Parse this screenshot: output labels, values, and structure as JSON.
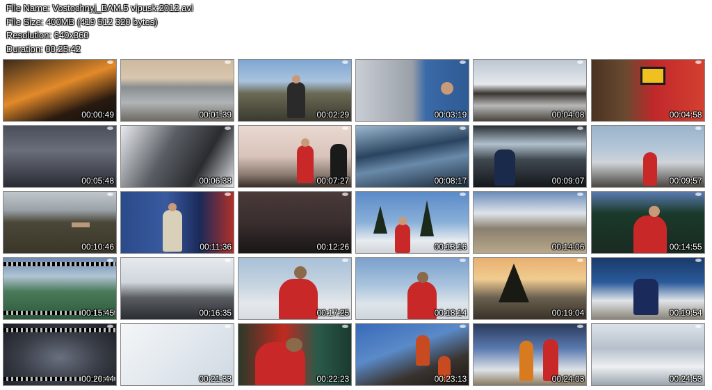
{
  "file_info": {
    "name_line": "File Name: Vostochnyj_BAM.5 vipusk:2012.avi",
    "size_line": "File Size: 400MB (419 512 320 bytes)",
    "resolution_line": "Resolution: 640x360",
    "duration_line": "Duration: 00:25:42"
  },
  "thumbnails": [
    {
      "time": "00:00:49",
      "bg": "linear-gradient(160deg,#3a2a1a 0%,#e28a2a 45%,#2a1a10 75%,#111 100%)"
    },
    {
      "time": "00:01:39",
      "bg": "linear-gradient(180deg,#cdb9a0 0%,#d8c6ae 30%,#8a8e90 45%,#b0b4b6 70%,#6e6a62 100%)"
    },
    {
      "time": "00:02:29",
      "bg": "linear-gradient(180deg,#7fa6d2 0%,#a9c3de 35%,#6a6a55 55%,#3a3a30 100%)"
    },
    {
      "time": "00:03:19",
      "bg": "linear-gradient(90deg,#c9cdd4 0%,#9aa0a8 50%,#3a6aa8 62%,#2f5a94 100%)"
    },
    {
      "time": "00:04:08",
      "bg": "linear-gradient(180deg,#bcc6d2 0%,#e5e8ec 40%,#3a3530 55%,#b8b8b8 75%,#4a443c 100%)"
    },
    {
      "time": "00:04:58",
      "bg": "linear-gradient(90deg,#4a3222 0%,#6a4a30 30%,#c0282a 55%,#d44030 100%)"
    },
    {
      "time": "00:05:48",
      "bg": "linear-gradient(180deg,#4a4e5a 0%,#6a6e7a 40%,#2a2c34 100%)"
    },
    {
      "time": "00:06:38",
      "bg": "linear-gradient(120deg,#e8eaee 0%,#5a5e64 40%,#2a2c30 70%,#dfe2e6 100%)"
    },
    {
      "time": "00:07:27",
      "bg": "linear-gradient(180deg,#e9d9d0 0%,#d9c3bb 50%,#8a7a70 80%,#3a2e28 100%)"
    },
    {
      "time": "00:08:17",
      "bg": "linear-gradient(170deg,#9cb8d0 0%,#2a4460 40%,#6a8aaa 60%,#1a2a3a 100%)"
    },
    {
      "time": "00:09:07",
      "bg": "linear-gradient(180deg,#2a3036 0%,#b0c0cc 30%,#404850 55%,#14181c 100%)"
    },
    {
      "time": "00:09:57",
      "bg": "linear-gradient(180deg,#9ab4cc 0%,#b6c8d8 40%,#cfd4d8 60%,#4a4640 100%)"
    },
    {
      "time": "00:10:46",
      "bg": "linear-gradient(180deg,#c0c6cc 0%,#9aa2a8 30%,#4a4638 50%,#3a3628 100%)"
    },
    {
      "time": "00:11:36",
      "bg": "linear-gradient(90deg,#2a4a8a 0%,#3a5aa0 40%,#1a2a5a 70%,#b0302a 100%)"
    },
    {
      "time": "00:12:26",
      "bg": "linear-gradient(180deg,#4a3a3a 0%,#3a2e2e 50%,#1a1616 100%)"
    },
    {
      "time": "00:13:16",
      "bg": "linear-gradient(180deg,#5a8ac8 0%,#8ab0d8 50%,#e8ecf0 80%,#d0d4d8 100%)"
    },
    {
      "time": "00:14:06",
      "bg": "linear-gradient(180deg,#6a8cb8 0%,#dfe4ea 35%,#8a8070 60%,#b8a88a 100%)"
    },
    {
      "time": "00:14:55",
      "bg": "linear-gradient(180deg,#5a7ab0 0%,#1a3a2a 35%,#1a2a22 100%)"
    },
    {
      "time": "00:15:45",
      "bg": "linear-gradient(180deg,#6a8ab0 0%,#b0c4d4 30%,#4a7a5a 55%,#2a5a3a 100%)"
    },
    {
      "time": "00:16:35",
      "bg": "linear-gradient(180deg,#e6eaee 0%,#d0d6dc 40%,#5a5e62 65%,#2a2e32 100%)"
    },
    {
      "time": "00:17:25",
      "bg": "linear-gradient(180deg,#a8c0d8 0%,#c6d4e0 45%,#e4e8ec 75%,#d8dce0 100%)"
    },
    {
      "time": "00:18:14",
      "bg": "linear-gradient(180deg,#7aa0cc 0%,#aac4de 45%,#dde4ea 75%,#cfd6dc 100%)"
    },
    {
      "time": "00:19:04",
      "bg": "linear-gradient(180deg,#e8b070 0%,#f0cc90 35%,#6a6050 65%,#3a3228 100%)"
    },
    {
      "time": "00:19:54",
      "bg": "linear-gradient(180deg,#1a3a6a 0%,#2a5a9a 40%,#e0e4e8 70%,#8a8478 100%)"
    },
    {
      "time": "00:20:44",
      "bg": "radial-gradient(ellipse at 50% 55%,#6a7080 0%,#3a3e48 50%,#1a1c22 100%)"
    },
    {
      "time": "00:21:33",
      "bg": "linear-gradient(135deg,#f4f6f8 0%,#e2e8ee 50%,#cfd8e2 100%)"
    },
    {
      "time": "00:22:23",
      "bg": "linear-gradient(90deg,#2a3a2a 0%,#c02a20 40%,#2a5a4a 70%,#1a3a2e 100%)"
    },
    {
      "time": "00:23:13",
      "bg": "linear-gradient(160deg,#3a6ab8 0%,#5a8ac8 40%,#3a3430 70%,#1a1612 100%)"
    },
    {
      "time": "00:24:03",
      "bg": "linear-gradient(180deg,#2a3a5a 0%,#5a7ab0 40%,#dde2e6 75%,#8a7a60 100%)"
    },
    {
      "time": "00:24:53",
      "bg": "linear-gradient(180deg,#dde2e8 0%,#b6c0cc 40%,#eef0f2 70%,#9aa4ae 100%)"
    }
  ],
  "colors": {
    "background": "#ffffff",
    "info_text": "#ffffff",
    "timestamp_text": "#ffffff"
  }
}
